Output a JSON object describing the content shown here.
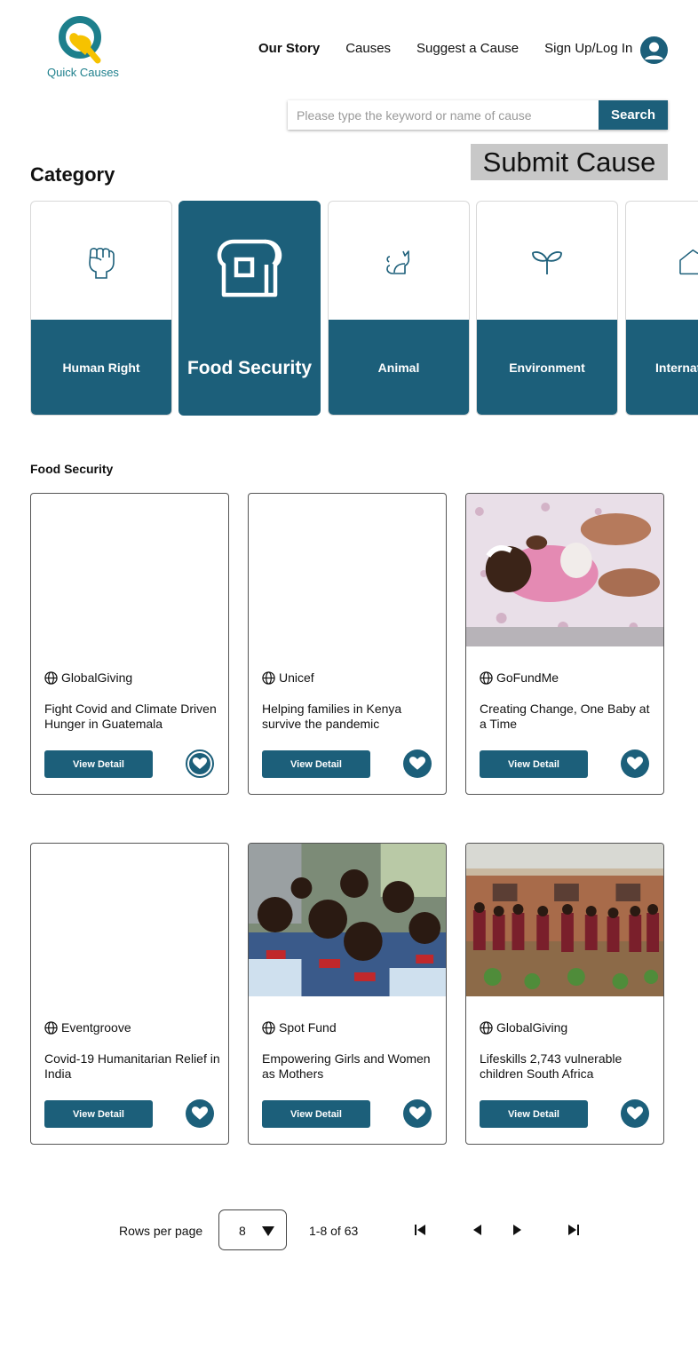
{
  "brand": {
    "name": "Quick Causes",
    "primary_color": "#1c5f7a",
    "accent_color": "#f6c200"
  },
  "nav": {
    "items": [
      {
        "label": "Our Story",
        "active": true
      },
      {
        "label": "Causes",
        "active": false
      },
      {
        "label": "Suggest a Cause",
        "active": false
      },
      {
        "label": "Sign Up/Log In",
        "active": false
      }
    ],
    "avatar_icon": "user-icon"
  },
  "search": {
    "placeholder": "Please type the keyword or name of cause",
    "value": "",
    "button_label": "Search"
  },
  "submit_cause_label": "Submit Cause",
  "category": {
    "title": "Category",
    "items": [
      {
        "label": "Human Right",
        "icon": "fist-icon",
        "selected": false
      },
      {
        "label": "Food Security",
        "icon": "bread-icon",
        "selected": true
      },
      {
        "label": "Animal",
        "icon": "cat-icon",
        "selected": false
      },
      {
        "label": "Environment",
        "icon": "sprout-icon",
        "selected": false
      },
      {
        "label": "Internat",
        "icon": "house-icon",
        "selected": false
      }
    ]
  },
  "results": {
    "section_title": "Food Security",
    "view_detail_label": "View Detail",
    "cards": [
      {
        "org": "GlobalGiving",
        "title": "Fight Covid and Climate Driven Hunger in Guatemala",
        "image": "none",
        "favorite_style": "outlined"
      },
      {
        "org": "Unicef",
        "title": "Helping families in Kenya survive the pandemic",
        "image": "none",
        "favorite_style": "filled"
      },
      {
        "org": "GoFundMe",
        "title": "Creating Change, One Baby at a Time",
        "image": "baby-photo",
        "favorite_style": "filled"
      },
      {
        "org": "Eventgroove",
        "title": "Covid-19 Humanitarian Relief in India",
        "image": "none",
        "favorite_style": "outlined"
      },
      {
        "org": "Spot Fund",
        "title": "Empowering Girls and Women as Mothers",
        "image": "children-group-photo",
        "favorite_style": "filled"
      },
      {
        "org": "GlobalGiving",
        "title": "Lifeskills 2,743 vulnerable children South Africa",
        "image": "school-children-photo",
        "favorite_style": "filled"
      }
    ]
  },
  "pagination": {
    "rows_label": "Rows per page",
    "rows_value": "8",
    "range_text": "1-8 of 63"
  }
}
